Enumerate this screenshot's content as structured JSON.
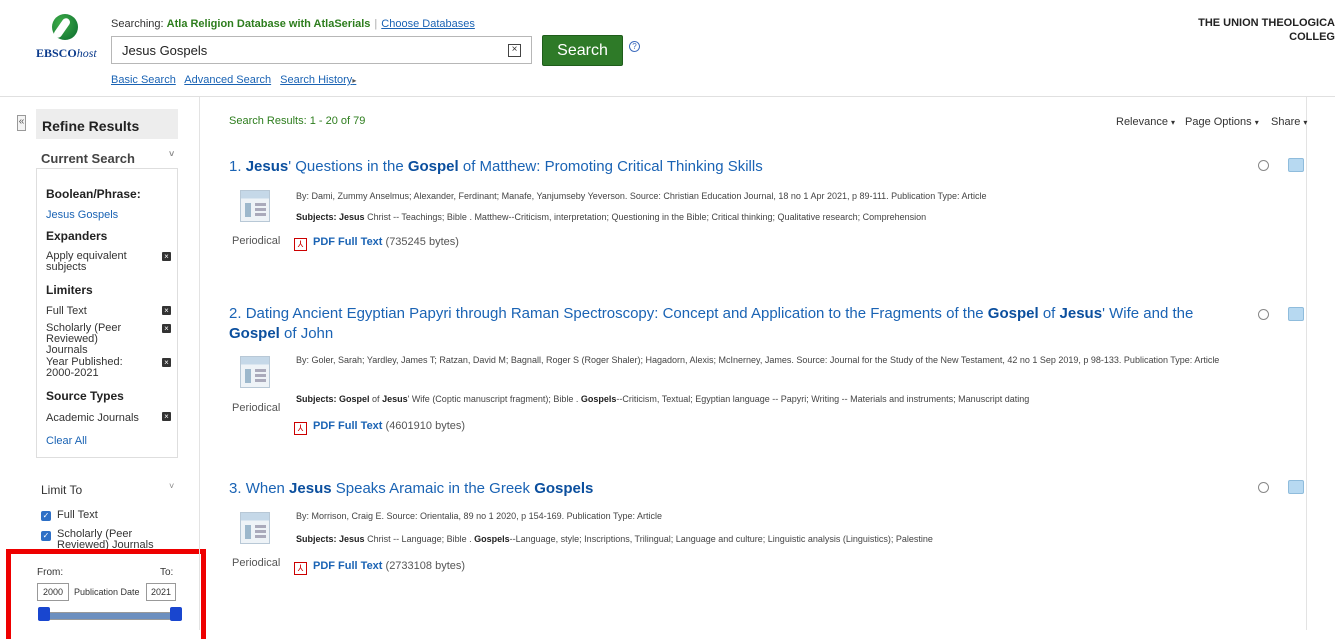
{
  "header": {
    "logo_text": "EBSCO",
    "logo_suffix": "host",
    "searching_prefix": "Searching:",
    "database_name": "Atla Religion Database with AtlaSerials",
    "choose_databases": "Choose Databases",
    "search_query": "Jesus Gospels",
    "clear_glyph": "×",
    "search_button": "Search",
    "help_glyph": "?",
    "links": [
      "Basic Search",
      "Advanced Search",
      "Search History"
    ],
    "history_caret": "▸",
    "institution_line1": "THE UNION THEOLOGICA",
    "institution_line2": "COLLEG"
  },
  "sidebar": {
    "collapse_glyph": "«",
    "refine_title": "Refine Results",
    "current_search": "Current Search",
    "chevron": "˅",
    "boolean_heading": "Boolean/Phrase:",
    "boolean_value": "Jesus Gospels",
    "expanders_heading": "Expanders",
    "expander_item": "Apply equivalent subjects",
    "limiters_heading": "Limiters",
    "limiter_items": [
      "Full Text",
      "Scholarly (Peer Reviewed) Journals",
      "Year Published: 2000-2021"
    ],
    "source_types_heading": "Source Types",
    "source_item": "Academic Journals",
    "remove_glyph": "×",
    "clear_all": "Clear All",
    "limit_to": "Limit To",
    "limit_options": [
      "Full Text",
      "Scholarly (Peer Reviewed) Journals"
    ],
    "check_glyph": "✓",
    "date_from_label": "From:",
    "date_to_label": "To:",
    "date_from": "2000",
    "date_to": "2021",
    "date_label": "Publication Date",
    "date_range_fraction": [
      0.0,
      1.0
    ]
  },
  "results": {
    "count_text": "Search Results: 1 - 20 of 79",
    "toolbar": [
      "Relevance",
      "Page Options",
      "Share"
    ],
    "caret": "▾",
    "periodical": "Periodical",
    "pdf_glyph": "⅄",
    "pdf_label": "PDF Full Text",
    "items": [
      {
        "num": "1.",
        "t": [
          "Jesus",
          "' Questions in the ",
          "Gospel",
          " of Matthew: Promoting Critical Thinking Skills"
        ],
        "by": "By: Dami, Zummy Anselmus; Alexander, Ferdinant; Manafe, Yanjumseby Yeverson. Source: Christian Education Journal, 18 no 1 Apr 2021, p 89-111. Publication Type: Article",
        "subjects_label": "Subjects:",
        "subjects_bold": "Jesus",
        "subjects_rest": " Christ -- Teachings; Bible . Matthew--Criticism, interpretation; Questioning in the Bible; Critical thinking; Qualitative research; Comprehension",
        "size": "(735245 bytes)"
      },
      {
        "num": "2.",
        "t": [
          "Dating Ancient Egyptian Papyri through Raman Spectroscopy: Concept and Application to the Fragments of the ",
          "Gospel",
          " of ",
          "Jesus",
          "' Wife and the ",
          "Gospel",
          " of John"
        ],
        "by": "By: Goler, Sarah; Yardley, James T; Ratzan, David M; Bagnall, Roger S (Roger Shaler); Hagadorn, Alexis; McInerney, James. Source: Journal for the Study of the New Testament, 42 no 1 Sep 2019, p 98-133. Publication Type: Article",
        "subjects_label": "Subjects:",
        "subjects_bold": "Gospel",
        "subjects_mid": " of ",
        "subjects_bold2": "Jesus",
        "subjects_mid2": "' Wife (Coptic manuscript fragment); Bible . ",
        "subjects_bold3": "Gospels",
        "subjects_rest": "--Criticism, Textual; Egyptian language -- Papyri; Writing -- Materials and instruments; Manuscript dating",
        "size": "(4601910 bytes)"
      },
      {
        "num": "3.",
        "t": [
          "When ",
          "Jesus",
          " Speaks Aramaic in the Greek ",
          "Gospels"
        ],
        "by": "By: Morrison, Craig E. Source: Orientalia, 89 no 1 2020, p 154-169. Publication Type: Article",
        "subjects_label": "Subjects:",
        "subjects_bold": "Jesus",
        "subjects_mid": " Christ -- Language; Bible . ",
        "subjects_bold2": "Gospels",
        "subjects_rest": "--Language, style; Inscriptions, Trilingual; Language and culture; Linguistic analysis (Linguistics); Palestine",
        "size": "(2733108 bytes)"
      }
    ]
  },
  "colors": {
    "accent_green": "#2e7a28",
    "link_blue": "#1a63b4",
    "highlight_red": "#e00000",
    "slider_handle": "#1946cf"
  }
}
